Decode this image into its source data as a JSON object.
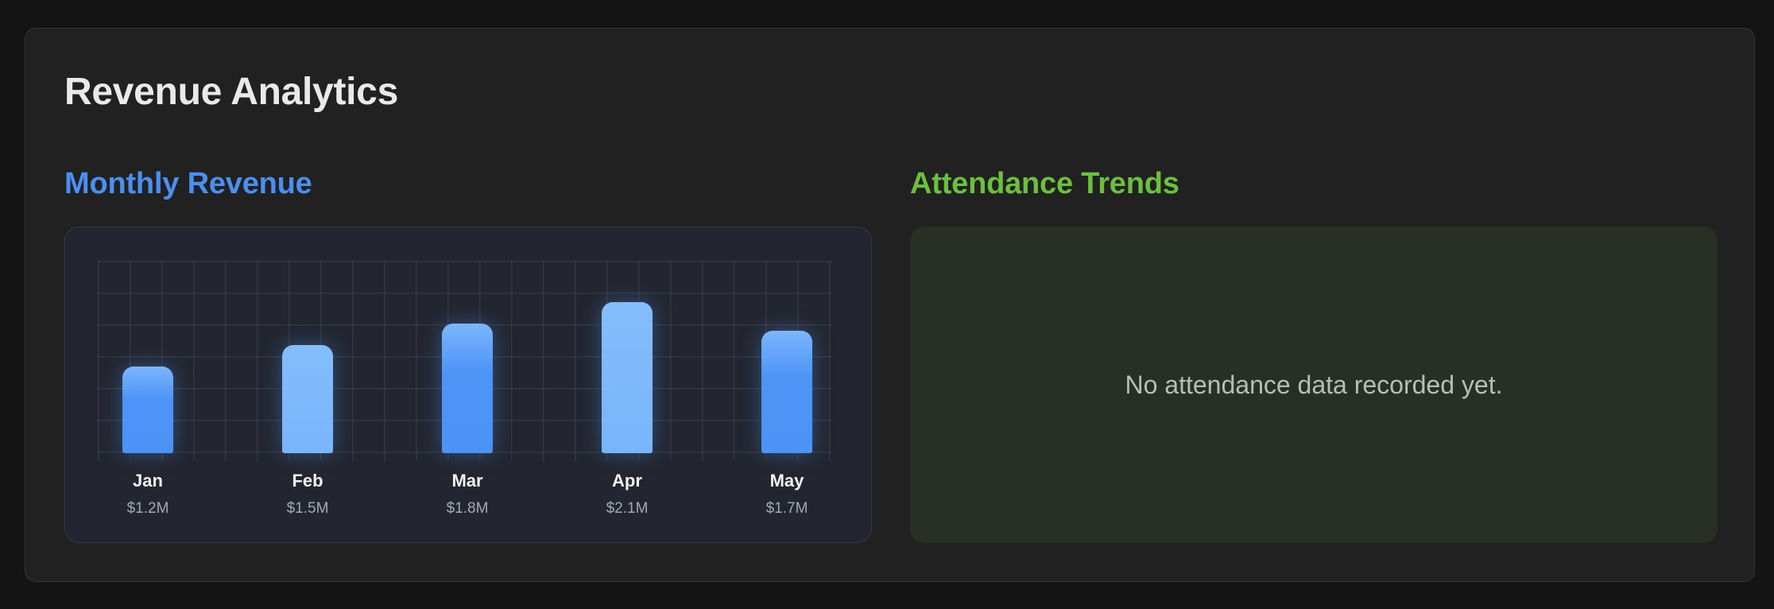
{
  "page": {
    "title": "Revenue Analytics"
  },
  "revenue_section": {
    "title": "Monthly Revenue",
    "accent_color": "#4b8ff2"
  },
  "attendance_section": {
    "title": "Attendance Trends",
    "accent_color": "#6cbf3f",
    "empty_message": "No attendance data recorded yet."
  },
  "chart_data": {
    "type": "bar",
    "categories": [
      "Jan",
      "Feb",
      "Mar",
      "Apr",
      "May"
    ],
    "values": [
      1.2,
      1.5,
      1.8,
      2.1,
      1.7
    ],
    "value_labels": [
      "$1.2M",
      "$1.5M",
      "$1.8M",
      "$2.1M",
      "$1.7M"
    ],
    "title": "Monthly Revenue",
    "grid": true,
    "legend": "none"
  }
}
